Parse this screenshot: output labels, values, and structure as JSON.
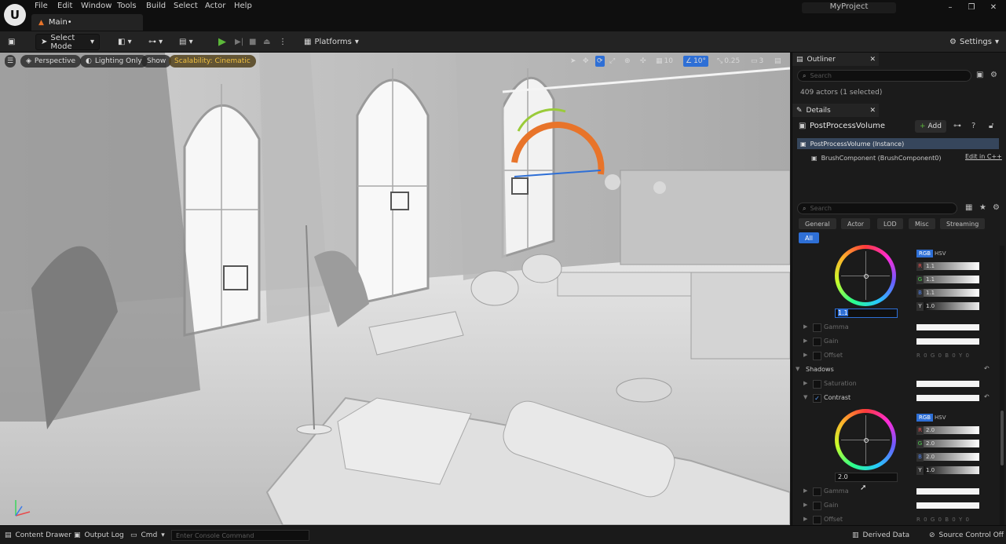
{
  "menu": [
    "File",
    "Edit",
    "Window",
    "Tools",
    "Build",
    "Select",
    "Actor",
    "Help"
  ],
  "tab": {
    "label": "Main•"
  },
  "project": "MyProject",
  "toolbar": {
    "select_mode": "Select Mode",
    "platforms": "Platforms",
    "settings": "Settings"
  },
  "viewport": {
    "perspective": "Perspective",
    "lighting": "Lighting Only",
    "show": "Show",
    "scalability": "Scalability: Cinematic",
    "grid": "10",
    "angle": "10°",
    "scale": "0.25",
    "camera": "3"
  },
  "outliner": {
    "title": "Outliner",
    "search_placeholder": "Search",
    "count": "409 actors (1 selected)"
  },
  "details": {
    "title": "Details",
    "actor": "PostProcessVolume",
    "add": "Add",
    "instance": "PostProcessVolume (Instance)",
    "component": "BrushComponent (BrushComponent0)",
    "edit_cpp": "Edit in C++",
    "search_placeholder": "Search",
    "tabs": [
      "General",
      "Actor",
      "LOD",
      "Misc",
      "Streaming"
    ],
    "tab_all": "All"
  },
  "color1": {
    "mode_rgb": "RGB",
    "mode_hsv": "HSV",
    "r": "1.1",
    "g": "1.1",
    "b": "1.1",
    "y": "1.0",
    "input": "1.1"
  },
  "rows1": [
    "Gamma",
    "Gain",
    "Offset"
  ],
  "offset_chan": [
    "R",
    "0",
    "G",
    "0",
    "B",
    "0",
    "Y",
    "0"
  ],
  "shadows": {
    "label": "Shadows",
    "saturation": "Saturation",
    "contrast": "Contrast"
  },
  "color2": {
    "mode_rgb": "RGB",
    "mode_hsv": "HSV",
    "r": "2.0",
    "g": "2.0",
    "b": "2.0",
    "y": "1.0",
    "input": "2.0"
  },
  "rows2": [
    "Gamma",
    "Gain",
    "Offset"
  ],
  "status": {
    "content_drawer": "Content Drawer",
    "output_log": "Output Log",
    "cmd": "Cmd",
    "console_placeholder": "Enter Console Command",
    "derived_data": "Derived Data",
    "source_control": "Source Control Off"
  },
  "colors": {
    "accent_blue": "#2e6fd6",
    "play_green": "#5cb83a",
    "scalability_gold": "#f0c040",
    "gizmo_orange": "#e8742a"
  }
}
